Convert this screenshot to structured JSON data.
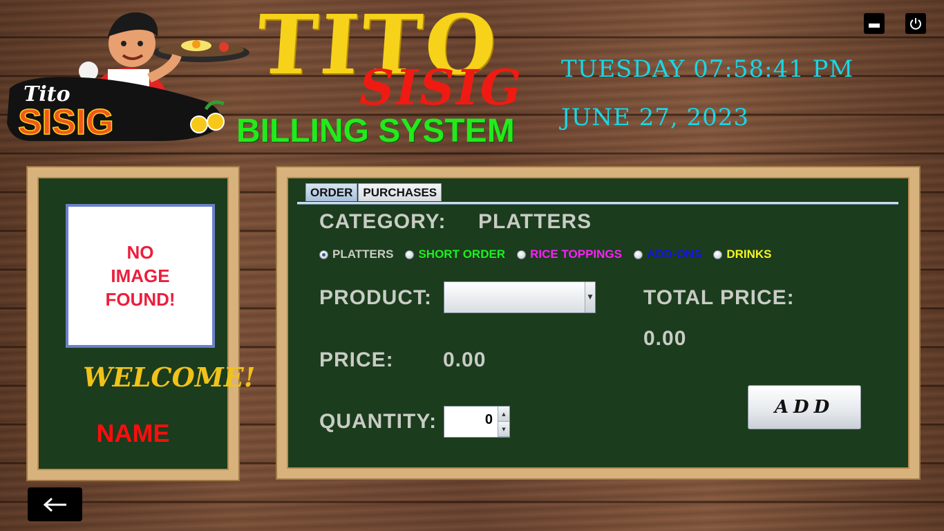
{
  "header": {
    "title_line1": "TITO",
    "title_line2": "SISIG",
    "title_line3": "BILLING SYSTEM",
    "logo_text_top": "Tito",
    "logo_text_bottom": "SISIG"
  },
  "clock": {
    "day_time": "TUESDAY 07:58:41 PM",
    "date": "JUNE 27, 2023"
  },
  "window_controls": {
    "minimize_icon": "minimize-icon",
    "power_icon": "power-icon"
  },
  "profile": {
    "no_image_text": "NO\nIMAGE\nFOUND!",
    "welcome": "WELCOME!",
    "name": "NAME"
  },
  "tabs": [
    {
      "label": "ORDER",
      "active": true
    },
    {
      "label": "PURCHASES",
      "active": false
    }
  ],
  "order": {
    "category_label": "CATEGORY:",
    "category_value": "PLATTERS",
    "categories": [
      {
        "label": "PLATTERS",
        "color": "#c9ccc5",
        "selected": true
      },
      {
        "label": "SHORT ORDER",
        "color": "#1ef01e",
        "selected": false
      },
      {
        "label": "RICE TOPPINGS",
        "color": "#ff1eff",
        "selected": false
      },
      {
        "label": "ADD-ONS",
        "color": "#1414e6",
        "selected": false
      },
      {
        "label": "DRINKS",
        "color": "#f5f51e",
        "selected": false
      }
    ],
    "product_label": "PRODUCT:",
    "product_value": "",
    "price_label": "PRICE:",
    "price_value": "0.00",
    "quantity_label": "QUANTITY:",
    "quantity_value": "0",
    "total_label": "TOTAL PRICE:",
    "total_value": "0.00",
    "add_button": "ADD"
  },
  "colors": {
    "board": "#1b3c1d",
    "frame": "#d8b27c",
    "clock": "#19d7e6",
    "label": "#c9ccc5"
  }
}
